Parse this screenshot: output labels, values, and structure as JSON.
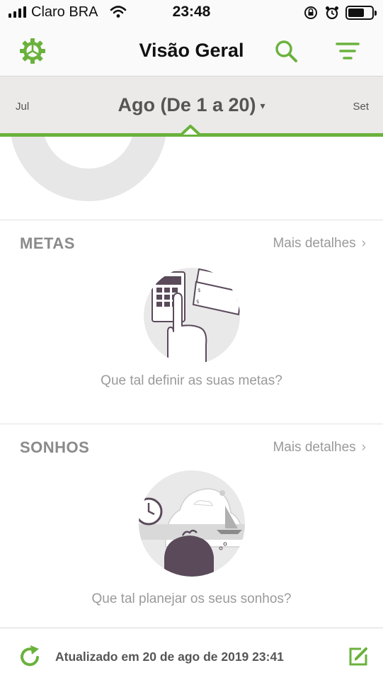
{
  "status_bar": {
    "carrier": "Claro BRA",
    "time": "23:48",
    "signal_bars": 4,
    "icons": [
      "signal-icon",
      "wifi-icon",
      "rotation-lock-icon",
      "alarm-icon",
      "battery-icon"
    ]
  },
  "nav": {
    "title": "Visão Geral",
    "icons": [
      "settings-icon",
      "search-icon",
      "filter-icon"
    ],
    "accent_color": "#6ab23c"
  },
  "month_selector": {
    "previous": "Jul",
    "current": "Ago (De 1 a 20)",
    "caret": "▾",
    "next": "Set"
  },
  "metas": {
    "title": "METAS",
    "link": "Mais detalhes",
    "chevron": "›",
    "caption": "Que tal definir as suas metas?"
  },
  "sonhos": {
    "title": "SONHOS",
    "link": "Mais detalhes",
    "chevron": "›",
    "caption": "Que tal planejar os seus sonhos?"
  },
  "footer": {
    "updated_text": "Atualizado em 20 de ago de 2019 23:41",
    "icons": [
      "refresh-icon",
      "edit-icon"
    ]
  }
}
